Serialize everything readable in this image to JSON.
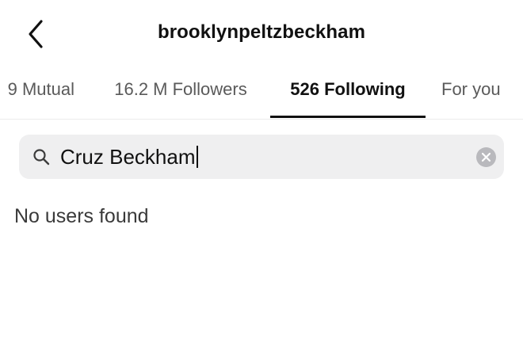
{
  "header": {
    "title": "brooklynpeltzbeckham",
    "back_icon": "chevron-left-icon"
  },
  "tabs": [
    {
      "label": "9 Mutual",
      "active": false
    },
    {
      "label": "16.2 M Followers",
      "active": false
    },
    {
      "label": "526 Following",
      "active": true
    },
    {
      "label": "For you",
      "active": false
    }
  ],
  "search": {
    "icon": "search-icon",
    "value": "Cruz Beckham",
    "clear_icon": "clear-icon"
  },
  "results": {
    "empty_message": "No users found"
  },
  "colors": {
    "background": "#ffffff",
    "text_primary": "#111111",
    "text_secondary": "#5a5a5a",
    "search_background": "#efeff0",
    "active_tab_indicator": "#111111"
  }
}
